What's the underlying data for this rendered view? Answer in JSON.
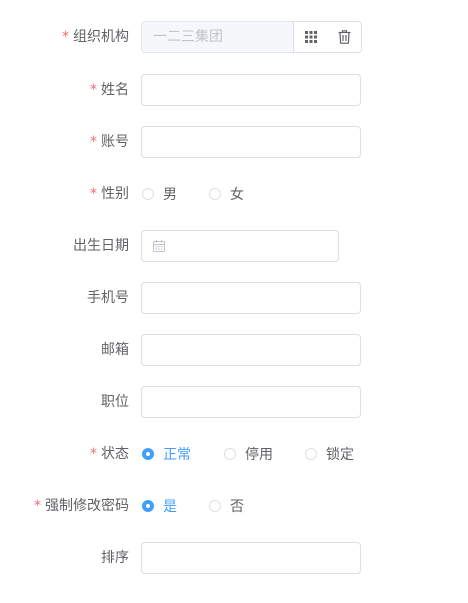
{
  "form": {
    "org": {
      "label": "组织机构",
      "required": "*",
      "value": "一二三集团",
      "select_icon": "grid-icon",
      "clear_icon": "trash-icon"
    },
    "name": {
      "label": "姓名",
      "required": "*",
      "value": ""
    },
    "account": {
      "label": "账号",
      "required": "*",
      "value": ""
    },
    "gender": {
      "label": "性别",
      "required": "*",
      "options": [
        "男",
        "女"
      ],
      "selected": null
    },
    "birthday": {
      "label": "出生日期",
      "value": "",
      "icon": "calendar-icon"
    },
    "phone": {
      "label": "手机号",
      "value": ""
    },
    "email": {
      "label": "邮箱",
      "value": ""
    },
    "position": {
      "label": "职位",
      "value": ""
    },
    "status": {
      "label": "状态",
      "required": "*",
      "options": [
        "正常",
        "停用",
        "锁定"
      ],
      "selected": "正常"
    },
    "force_pwd": {
      "label": "强制修改密码",
      "required": "*",
      "options": [
        "是",
        "否"
      ],
      "selected": "是"
    },
    "sort": {
      "label": "排序",
      "value": ""
    }
  },
  "colors": {
    "required": "#f56c6c",
    "accent": "#409eff",
    "border": "#dcdfe6",
    "text": "#606266",
    "placeholder": "#c0c4cc"
  }
}
